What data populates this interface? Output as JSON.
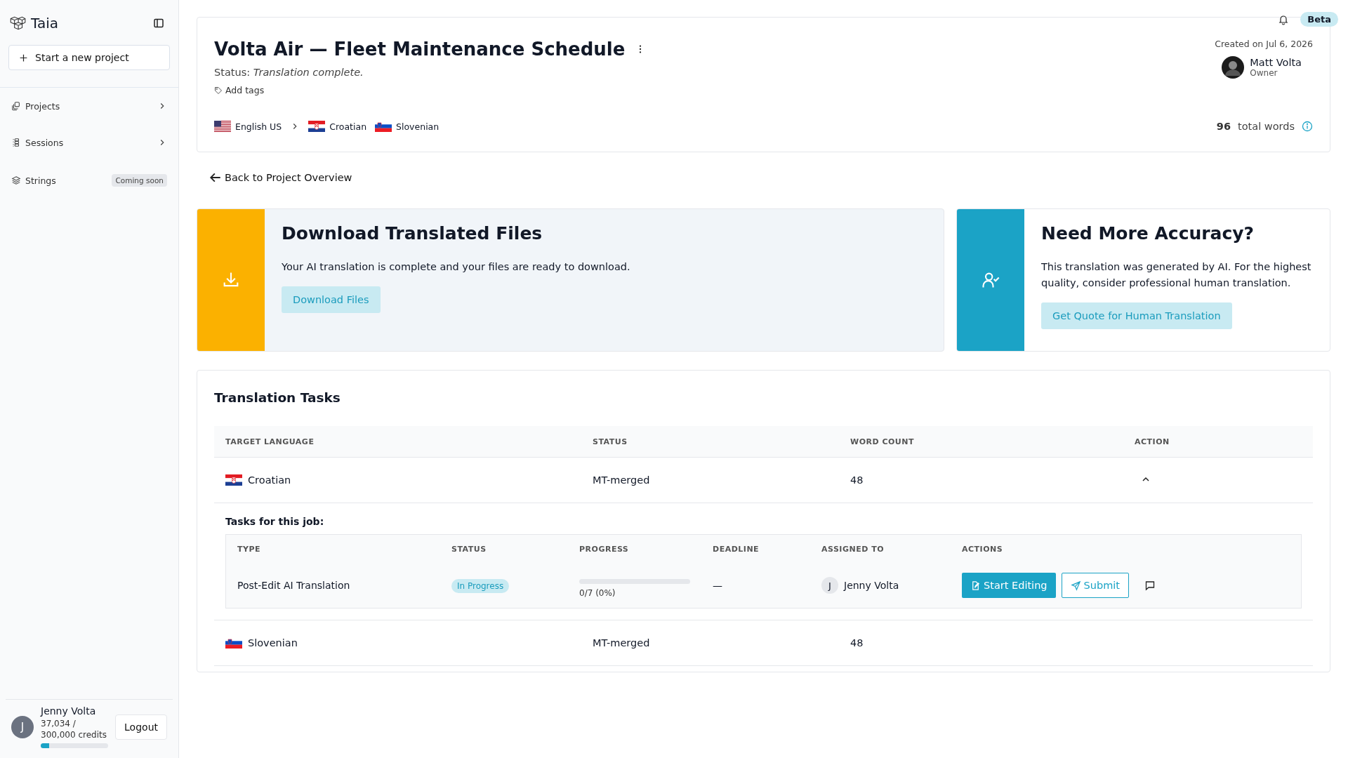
{
  "sidebar": {
    "brand": "Taia",
    "new_project_button": "Start a new project",
    "items": [
      {
        "label": "Projects",
        "kind": "expand"
      },
      {
        "label": "Sessions",
        "kind": "expand"
      },
      {
        "label": "Strings",
        "kind": "badge",
        "badge": "Coming soon"
      }
    ],
    "user": {
      "initial": "J",
      "name": "Jenny Volta",
      "credits": "37,034 / 300,000 credits",
      "level": 0.123
    },
    "logout_button": "Logout"
  },
  "top_bar": {
    "badge": "Beta"
  },
  "project": {
    "title": "Volta Air — Fleet Maintenance Schedule",
    "status_label": "Status:",
    "status": "Translation complete.",
    "add_tags": "Add tags",
    "source_language": {
      "name": "English US"
    },
    "target_languages": [
      {
        "name": "Croatian"
      },
      {
        "name": "Slovenian"
      }
    ],
    "created": "Created on Jul 6, 2026",
    "owner": {
      "name": "Matt Volta",
      "role": "Owner"
    },
    "total_words_count": "96",
    "total_words_label": "total words"
  },
  "back_link": "Back to Project Overview",
  "download_card": {
    "title": "Download Translated Files",
    "text": "Your AI translation is complete and your files are ready to download.",
    "button": "Download Files"
  },
  "accuracy_card": {
    "title": "Need More Accuracy?",
    "text": "This translation was generated by AI. For the highest quality, consider professional human translation.",
    "button": "Get Quote for Human Translation"
  },
  "tasks": {
    "title": "Translation Tasks",
    "columns": [
      "TARGET LANGUAGE",
      "STATUS",
      "WORD COUNT",
      "ACTION"
    ],
    "rows": [
      {
        "language": "Croatian",
        "status": "MT-merged",
        "word_count": "48",
        "expanded": true,
        "subtasks": {
          "title": "Tasks for this job:",
          "columns": [
            "TYPE",
            "STATUS",
            "PROGRESS",
            "DEADLINE",
            "ASSIGNED TO",
            "ACTIONS"
          ],
          "rows": [
            {
              "type": "Post-Edit AI Translation",
              "status": "In Progress",
              "level": 0,
              "progress": "0/7 (0%)",
              "deadline": "—",
              "assignee_initial": "J",
              "assignee": "Jenny Volta",
              "edit_button": "Start Editing",
              "submit_button": "Submit"
            }
          ]
        }
      },
      {
        "language": "Slovenian",
        "status": "MT-merged",
        "word_count": "48"
      }
    ]
  }
}
